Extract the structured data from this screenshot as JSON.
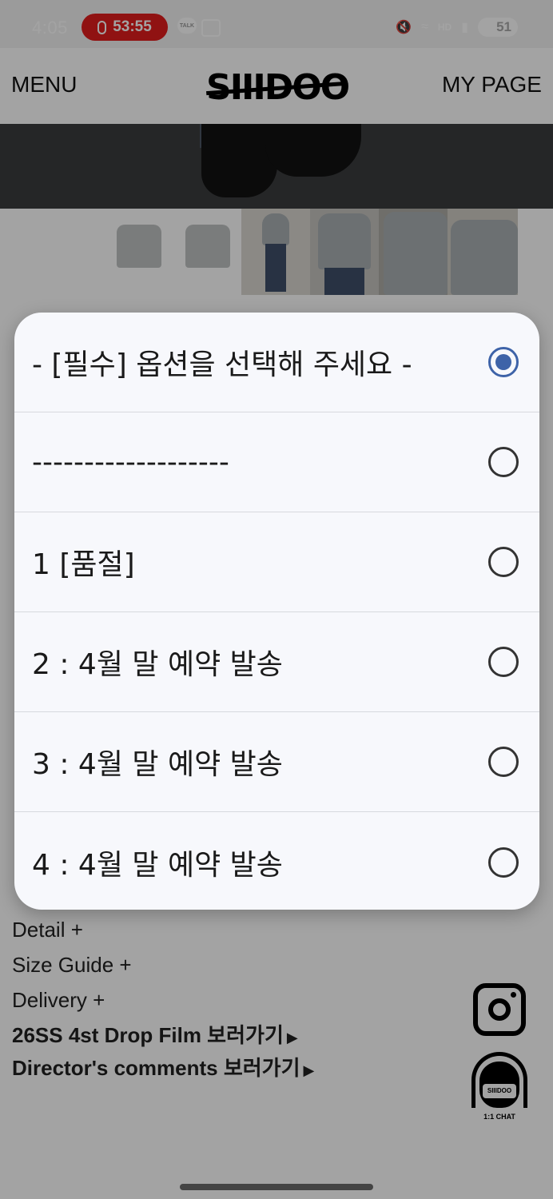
{
  "status_bar": {
    "time": "4:05",
    "recording_time": "53:55",
    "talk_label": "TALK",
    "hd_label": "HD",
    "battery": "51"
  },
  "header": {
    "menu_label": "MENU",
    "logo_text": "SIIIDOO",
    "mypage_label": "MY PAGE"
  },
  "options_dialog": {
    "options": [
      {
        "label": "- [필수] 옵션을 선택해 주세요 -",
        "selected": true
      },
      {
        "label": "-------------------",
        "selected": false
      },
      {
        "label": "1 [품절]",
        "selected": false
      },
      {
        "label": "2 : 4월 말 예약 발송",
        "selected": false
      },
      {
        "label": "3 : 4월 말 예약 발송",
        "selected": false
      },
      {
        "label": "4 : 4월 말 예약 발송",
        "selected": false
      }
    ],
    "accent_color": "#3e63a8"
  },
  "info_links": {
    "detail": "Detail +",
    "size_guide": "Size Guide +",
    "delivery": "Delivery +",
    "film": "26SS 4st Drop Film 보러가기",
    "comments": "Director's comments 보러가기"
  },
  "chat_widget": {
    "logo": "SIIIDOO",
    "label": "1:1 CHAT"
  }
}
